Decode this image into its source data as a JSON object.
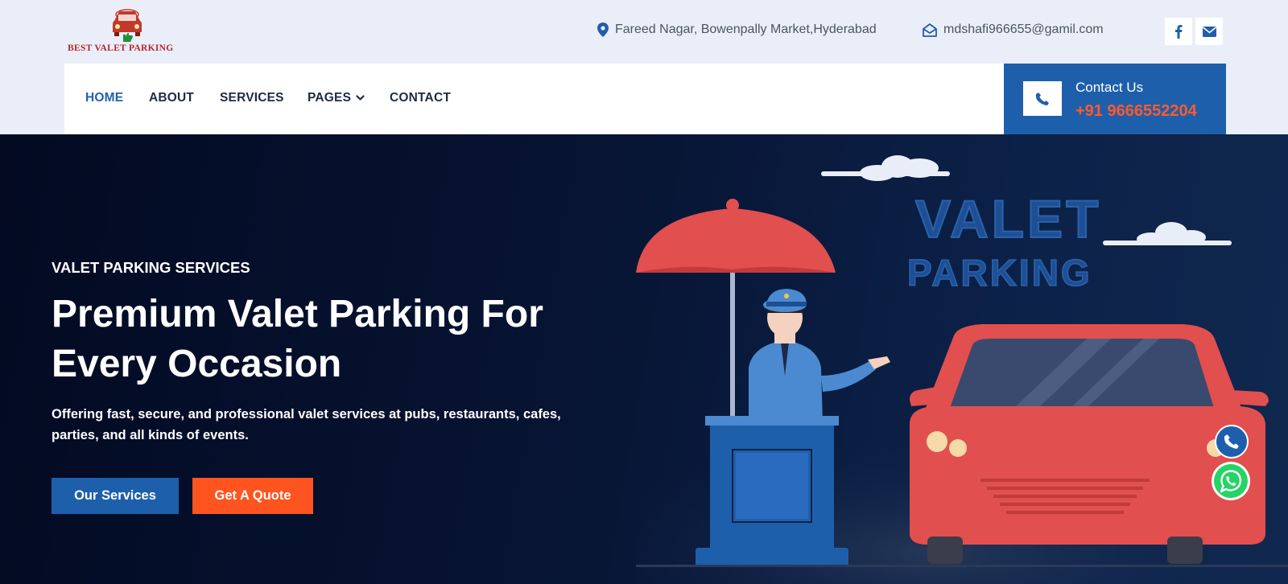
{
  "brand": {
    "name": "BEST VALET PARKING"
  },
  "top_info": {
    "address": "Fareed Nagar, Bowenpally Market,Hyderabad",
    "email": "mdshafi966655@gamil.com"
  },
  "social": [
    {
      "icon": "facebook-icon"
    },
    {
      "icon": "envelope-icon"
    }
  ],
  "nav": {
    "items": [
      {
        "label": "HOME",
        "active": true
      },
      {
        "label": "ABOUT"
      },
      {
        "label": "SERVICES"
      },
      {
        "label": "PAGES",
        "has_dropdown": true
      },
      {
        "label": "CONTACT"
      }
    ]
  },
  "contact": {
    "label": "Contact Us",
    "phone": "+91 9666552204"
  },
  "hero": {
    "eyebrow": "VALET PARKING SERVICES",
    "title": "Premium Valet Parking For Every Occasion",
    "description": "Offering fast, secure, and professional valet services at pubs, restaurants, cafes, parties, and all kinds of events.",
    "primary_button": "Our Services",
    "secondary_button": "Get A Quote",
    "art_text_line1": "VALET",
    "art_text_line2": "PARKING"
  },
  "colors": {
    "brand_blue": "#1e5fab",
    "accent_orange": "#ff5420",
    "hero_bg": "#071433",
    "car_red": "#e24f4f",
    "whatsapp_green": "#25d366"
  }
}
